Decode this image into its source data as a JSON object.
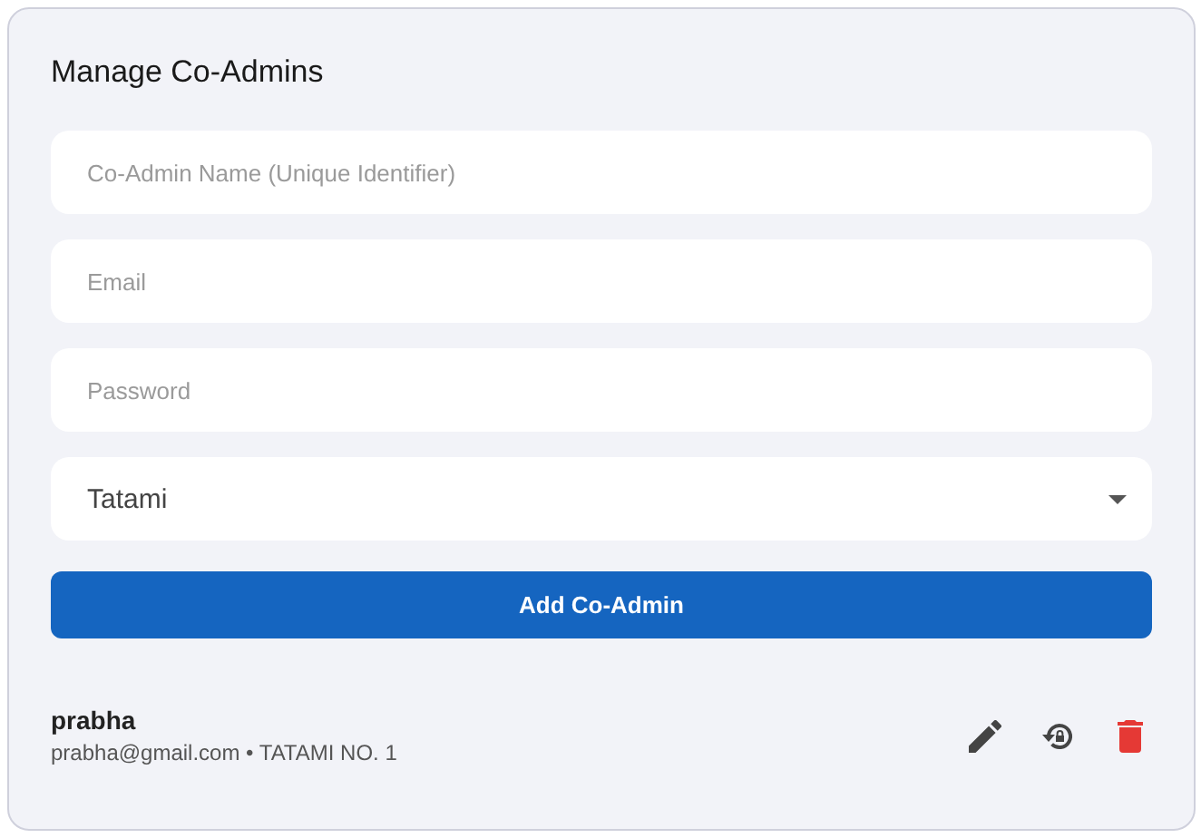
{
  "title": "Manage Co-Admins",
  "fields": [
    {
      "kind": "text",
      "placeholder": "Co-Admin Name (Unique Identifier)"
    },
    {
      "kind": "text",
      "placeholder": "Email"
    },
    {
      "kind": "password",
      "placeholder": "Password"
    },
    {
      "kind": "select",
      "value": "Tatami"
    }
  ],
  "add_button": "Add Co-Admin",
  "co_admins": [
    {
      "name": "prabha",
      "details": "prabha@gmail.com • TATAMI NO. 1"
    }
  ]
}
